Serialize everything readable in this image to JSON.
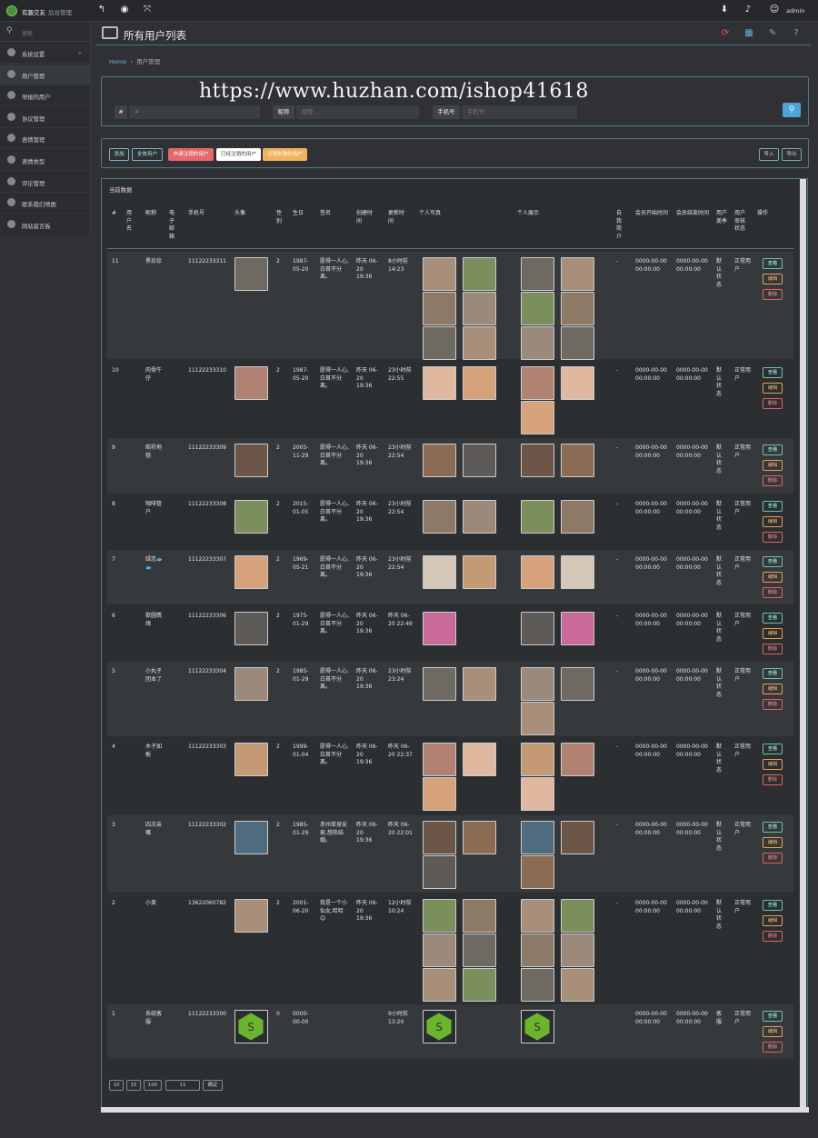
{
  "app": {
    "brand": "有趣交友",
    "brand_sub": "后台管理",
    "admin": "admin"
  },
  "sidebar": {
    "search": "搜索",
    "items": [
      {
        "label": "系统设置"
      },
      {
        "label": "用户管理"
      },
      {
        "label": "举报的用户"
      },
      {
        "label": "协议管理"
      },
      {
        "label": "表情管理"
      },
      {
        "label": "表情类型"
      },
      {
        "label": "评论管理"
      },
      {
        "label": "联系我们地图"
      },
      {
        "label": "网站留言板"
      }
    ]
  },
  "page": {
    "title": "所有用户列表"
  },
  "breadcrumb": {
    "home": "Home",
    "current": "用户管理"
  },
  "watermark": "https://www.huzhan.com/ishop41618",
  "search": {
    "id_label": "#",
    "id_placeholder": "#",
    "nick_label": "昵称",
    "nick_placeholder": "昵称",
    "phone_label": "手机号",
    "phone_placeholder": "手机号"
  },
  "actions": {
    "add": "添加",
    "all": "全体用户",
    "filter1": "申请注销的用户",
    "filter2": "已经注销的用户",
    "filter3": "注销失败的用户",
    "import": "导入",
    "export": "导出"
  },
  "table": {
    "title": "当前数据",
    "headers": {
      "id": "#",
      "username": "用户名",
      "nickname": "昵称",
      "email": "电子邮箱",
      "phone": "手机号",
      "avatar": "头像",
      "gender": "性别",
      "birthday": "生日",
      "signature": "签名",
      "created": "创建时间",
      "updated": "更新时间",
      "photos": "个人写真",
      "display": "个人展示",
      "intro": "自我简介",
      "vip_start": "会员开始时间",
      "vip_end": "会员结束时间",
      "status": "用户美季",
      "audit": "用户审核状态",
      "ops": "操作"
    },
    "ops": {
      "view": "查看",
      "edit": "编辑",
      "delete": "删除"
    },
    "rows": [
      {
        "id": "11",
        "nickname": "黑珍珍",
        "phone": "11122233311",
        "gender": "2",
        "birthday": "1987-05-20",
        "signature": "愿得一人心,白首不分离。",
        "created": "昨天 06-20 19:36",
        "updated": "8小时前 14:23",
        "intro": "-",
        "vip_start": "0000-00-00 00:00:00",
        "vip_end": "0000-00-00 00:00:00",
        "status": "默认状态",
        "audit": "正常用户"
      },
      {
        "id": "10",
        "nickname": "肉骨牛仔",
        "phone": "11122233310",
        "gender": "2",
        "birthday": "1987-05-20",
        "signature": "愿得一人心,白首不分离。",
        "created": "昨天 06-20 19:36",
        "updated": "23小时前 22:55",
        "intro": "-",
        "vip_start": "0000-00-00 00:00:00",
        "vip_end": "0000-00-00 00:00:00",
        "status": "默认状态",
        "audit": "正常用户"
      },
      {
        "id": "9",
        "nickname": "皓符地毯",
        "phone": "11122233309",
        "gender": "2",
        "birthday": "2005-11-29",
        "signature": "愿得一人心,白首不分离。",
        "created": "昨天 06-20 19:36",
        "updated": "23小时前 22:54",
        "intro": "-",
        "vip_start": "0000-00-00 00:00:00",
        "vip_end": "0000-00-00 00:00:00",
        "status": "默认状态",
        "audit": "正常用户"
      },
      {
        "id": "8",
        "nickname": "咖啡管户",
        "phone": "11122233308",
        "gender": "2",
        "birthday": "2015-01-05",
        "signature": "愿得一人心,白首不分离。",
        "created": "昨天 06-20 19:36",
        "updated": "23小时前 22:54",
        "intro": "-",
        "vip_start": "0000-00-00 00:00:00",
        "vip_end": "0000-00-00 00:00:00",
        "status": "默认状态",
        "audit": "正常用户"
      },
      {
        "id": "7",
        "nickname": "绿恋🐟🐟",
        "phone": "11122233307",
        "gender": "2",
        "birthday": "1969-05-21",
        "signature": "愿得一人心,白首不分离。",
        "created": "昨天 06-20 19:36",
        "updated": "23小时前 22:54",
        "intro": "-",
        "vip_start": "0000-00-00 00:00:00",
        "vip_end": "0000-00-00 00:00:00",
        "status": "默认状态",
        "audit": "正常用户"
      },
      {
        "id": "6",
        "nickname": "歌圆情绪",
        "phone": "11122233306",
        "gender": "2",
        "birthday": "1975-01-29",
        "signature": "愿得一人心,白首不分离。",
        "created": "昨天 06-20 19:36",
        "updated": "昨天 06-20 22:49",
        "intro": "-",
        "vip_start": "0000-00-00 00:00:00",
        "vip_end": "0000-00-00 00:00:00",
        "status": "默认状态",
        "audit": "正常用户"
      },
      {
        "id": "5",
        "nickname": "小丸子团本了",
        "phone": "11122233304",
        "gender": "2",
        "birthday": "1985-01-29",
        "signature": "愿得一人心,白首不分离。",
        "created": "昨天 06-20 19:36",
        "updated": "23小时前 23:24",
        "intro": "-",
        "vip_start": "0000-00-00 00:00:00",
        "vip_end": "0000-00-00 00:00:00",
        "status": "默认状态",
        "audit": "正常用户"
      },
      {
        "id": "4",
        "nickname": "木子如栀",
        "phone": "11122233303",
        "gender": "2",
        "birthday": "1999-01-04",
        "signature": "愿得一人心,白首不分离。",
        "created": "昨天 06-20 19:36",
        "updated": "昨天 06-20 22:37",
        "intro": "-",
        "vip_start": "0000-00-00 00:00:00",
        "vip_end": "0000-00-00 00:00:00",
        "status": "默认状态",
        "audit": "正常用户"
      },
      {
        "id": "3",
        "nickname": "四次亲嘴",
        "phone": "11122233302",
        "gender": "2",
        "birthday": "1985-01-29",
        "signature": "赤州单身安家,想热结婚。",
        "created": "昨天 06-20 19:36",
        "updated": "昨天 06-20 22:01",
        "intro": "-",
        "vip_start": "0000-00-00 00:00:00",
        "vip_end": "0000-00-00 00:00:00",
        "status": "默认状态",
        "audit": "正常用户"
      },
      {
        "id": "2",
        "nickname": "小美",
        "phone": "13622060782",
        "gender": "2",
        "birthday": "2001-06-20",
        "signature": "我是一个小仙女,哈哈😊",
        "created": "昨天 06-20 19:36",
        "updated": "12小时前 10:24",
        "intro": "-",
        "vip_start": "0000-00-00 00:00:00",
        "vip_end": "0000-00-00 00:00:00",
        "status": "默认状态",
        "audit": "正常用户"
      },
      {
        "id": "1",
        "nickname": "系统客服",
        "phone": "11122233300",
        "gender": "0",
        "birthday": "0000-00-00",
        "signature": "",
        "created": "",
        "updated": "9小时前 13:20",
        "intro": "",
        "vip_start": "0000-00-00 00:00:00",
        "vip_end": "0000-00-00 00:00:00",
        "status": "客服",
        "audit": "正常用户"
      }
    ]
  },
  "pager": {
    "p1": "10",
    "p2": "15",
    "p3": "100",
    "current": "11",
    "go": "确定"
  }
}
